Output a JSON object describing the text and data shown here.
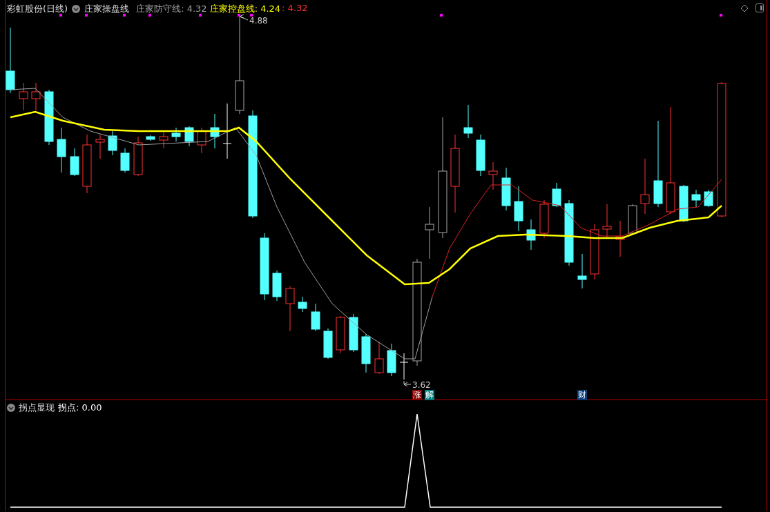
{
  "main_panel": {
    "title": "彩虹股份(日线)",
    "indicator": "庄家操盘线",
    "legend": [
      {
        "text": "庄家防守线: 4.32",
        "color": "#a0a0a0"
      },
      {
        "text": "庄家控盘线: 4.24",
        "color": "#ffff00"
      },
      {
        "text": ": 4.32",
        "color": "#ff3030"
      }
    ],
    "high_label": "4.88",
    "low_label": "3.62",
    "signals": [
      {
        "text": "涨",
        "color": "#8b0000"
      },
      {
        "text": "解",
        "color": "#008080"
      },
      {
        "text": "财",
        "color": "#0d3c78"
      }
    ]
  },
  "sub_panel": {
    "title": "拐点显现",
    "reading": "拐点: 0.00"
  }
}
